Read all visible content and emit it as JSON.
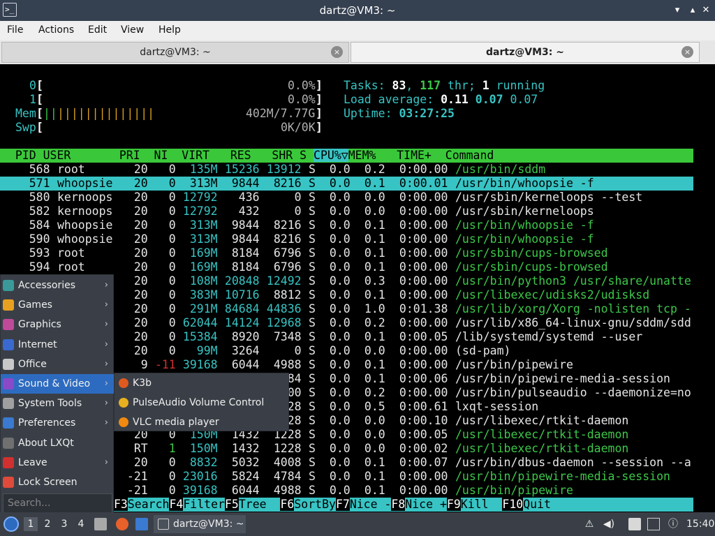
{
  "window": {
    "title": "dartz@VM3: ~",
    "min": "⌃",
    "max": "⌃",
    "close": "✕",
    "term_icon": ">_"
  },
  "menubar": [
    "File",
    "Actions",
    "Edit",
    "View",
    "Help"
  ],
  "tabs": [
    {
      "label": "dartz@VM3: ~",
      "close": "×"
    },
    {
      "label": "dartz@VM3: ~",
      "close": "×"
    }
  ],
  "htop": {
    "cpu0": {
      "num": "0",
      "open": "[",
      "pct": "0.0%",
      "close": "]"
    },
    "cpu1": {
      "num": "1",
      "open": "[",
      "pct": "0.0%",
      "close": "]"
    },
    "mem": {
      "label": "Mem",
      "open": "[",
      "bars": "||",
      "bars2": "||||||||||||||",
      "val": "402M/7.77G",
      "close": "]"
    },
    "swp": {
      "label": "Swp",
      "open": "[",
      "val": "0K/0K",
      "close": "]"
    },
    "tasks": {
      "label": "Tasks: ",
      "count": "83",
      "sep": ", ",
      "thr": "117",
      "thr_lbl": " thr; ",
      "running": "1",
      "running_lbl": " running"
    },
    "load": {
      "label": "Load average: ",
      "v1": "0.11",
      "v2": "0.07",
      "v3": "0.07"
    },
    "uptime": {
      "label": "Uptime: ",
      "value": "03:27:25"
    },
    "header": {
      "pre": "  PID USER       PRI  NI  VIRT   RES   SHR S ",
      "cpu": "CPU%▽",
      "post": "MEM%   TIME+  Command"
    },
    "rows": [
      {
        "pid": "568",
        "user": "root",
        "pri": "20",
        "ni": "0",
        "virt": "135M",
        "res": "15236",
        "shr": "13912",
        "s": "S",
        "cpu": "0.0",
        "mem": "0.2",
        "time": "0:00.00",
        "cmd": "/usr/bin/sddm",
        "cc": "g"
      },
      {
        "pid": "571",
        "user": "whoopsie",
        "pri": "20",
        "ni": "0",
        "virt": "313M",
        "res": "9844",
        "shr": "8216",
        "s": "S",
        "cpu": "0.0",
        "mem": "0.1",
        "time": "0:00.01",
        "cmd": "/usr/bin/whoopsie -f",
        "cc": "k"
      },
      {
        "pid": "580",
        "user": "kernoops",
        "pri": "20",
        "ni": "0",
        "virt": "12792",
        "res": "436",
        "shr": "0",
        "s": "S",
        "cpu": "0.0",
        "mem": "0.0",
        "time": "0:00.00",
        "cmd": "/usr/sbin/kerneloops --test",
        "cc": "w"
      },
      {
        "pid": "582",
        "user": "kernoops",
        "pri": "20",
        "ni": "0",
        "virt": "12792",
        "res": "432",
        "shr": "0",
        "s": "S",
        "cpu": "0.0",
        "mem": "0.0",
        "time": "0:00.00",
        "cmd": "/usr/sbin/kerneloops",
        "cc": "w"
      },
      {
        "pid": "584",
        "user": "whoopsie",
        "pri": "20",
        "ni": "0",
        "virt": "313M",
        "res": "9844",
        "shr": "8216",
        "s": "S",
        "cpu": "0.0",
        "mem": "0.1",
        "time": "0:00.00",
        "cmd": "/usr/bin/whoopsie -f",
        "cc": "g"
      },
      {
        "pid": "590",
        "user": "whoopsie",
        "pri": "20",
        "ni": "0",
        "virt": "313M",
        "res": "9844",
        "shr": "8216",
        "s": "S",
        "cpu": "0.0",
        "mem": "0.1",
        "time": "0:00.00",
        "cmd": "/usr/bin/whoopsie -f",
        "cc": "g"
      },
      {
        "pid": "593",
        "user": "root",
        "pri": "20",
        "ni": "0",
        "virt": "169M",
        "res": "8184",
        "shr": "6796",
        "s": "S",
        "cpu": "0.0",
        "mem": "0.1",
        "time": "0:00.00",
        "cmd": "/usr/sbin/cups-browsed",
        "cc": "g"
      },
      {
        "pid": "594",
        "user": "root",
        "pri": "20",
        "ni": "0",
        "virt": "169M",
        "res": "8184",
        "shr": "6796",
        "s": "S",
        "cpu": "0.0",
        "mem": "0.1",
        "time": "0:00.00",
        "cmd": "/usr/sbin/cups-browsed",
        "cc": "g"
      },
      {
        "pid": "",
        "user": "",
        "pri": "20",
        "ni": "0",
        "virt": "108M",
        "res": "20848",
        "shr": "12492",
        "s": "S",
        "cpu": "0.0",
        "mem": "0.3",
        "time": "0:00.00",
        "cmd": "/usr/bin/python3 /usr/share/unatte",
        "cc": "g"
      },
      {
        "pid": "",
        "user": "",
        "pri": "20",
        "ni": "0",
        "virt": "383M",
        "res": "10716",
        "shr": "8812",
        "s": "S",
        "cpu": "0.0",
        "mem": "0.1",
        "time": "0:00.00",
        "cmd": "/usr/libexec/udisks2/udisksd",
        "cc": "g"
      },
      {
        "pid": "",
        "user": "",
        "pri": "20",
        "ni": "0",
        "virt": "291M",
        "res": "84684",
        "shr": "44836",
        "s": "S",
        "cpu": "0.0",
        "mem": "1.0",
        "time": "0:01.38",
        "cmd": "/usr/lib/xorg/Xorg -nolisten tcp -",
        "cc": "g"
      },
      {
        "pid": "",
        "user": "",
        "pri": "20",
        "ni": "0",
        "virt": "62044",
        "res": "14124",
        "shr": "12968",
        "s": "S",
        "cpu": "0.0",
        "mem": "0.2",
        "time": "0:00.00",
        "cmd": "/usr/lib/x86_64-linux-gnu/sddm/sdd",
        "cc": "w"
      },
      {
        "pid": "",
        "user": "",
        "pri": "20",
        "ni": "0",
        "virt": "15384",
        "res": "8920",
        "shr": "7348",
        "s": "S",
        "cpu": "0.0",
        "mem": "0.1",
        "time": "0:00.05",
        "cmd": "/lib/systemd/systemd --user",
        "cc": "w"
      },
      {
        "pid": "",
        "user": "",
        "pri": "20",
        "ni": "0",
        "virt": "99M",
        "res": "3264",
        "shr": "0",
        "s": "S",
        "cpu": "0.0",
        "mem": "0.0",
        "time": "0:00.00",
        "cmd": "(sd-pam)",
        "cc": "w"
      },
      {
        "pid": "",
        "user": "",
        "pri": "9",
        "ni": "-11",
        "virt": "39168",
        "res": "6044",
        "shr": "4988",
        "s": "S",
        "cpu": "0.0",
        "mem": "0.1",
        "time": "0:00.00",
        "cmd": "/usr/bin/pipewire",
        "cc": "w"
      },
      {
        "pid": "",
        "user": "",
        "pri": "",
        "ni": "",
        "virt": "",
        "res": "",
        "shr": "84",
        "s": "S",
        "cpu": "0.0",
        "mem": "0.1",
        "time": "0:00.06",
        "cmd": "/usr/bin/pipewire-media-session",
        "cc": "w"
      },
      {
        "pid": "",
        "user": "",
        "pri": "",
        "ni": "",
        "virt": "",
        "res": "",
        "shr": "00",
        "s": "S",
        "cpu": "0.0",
        "mem": "0.2",
        "time": "0:00.00",
        "cmd": "/usr/bin/pulseaudio --daemonize=no",
        "cc": "w"
      },
      {
        "pid": "",
        "user": "",
        "pri": "",
        "ni": "",
        "virt": "",
        "res": "",
        "shr": "28",
        "s": "S",
        "cpu": "0.0",
        "mem": "0.5",
        "time": "0:00.61",
        "cmd": "lxqt-session",
        "cc": "w"
      },
      {
        "pid": "",
        "user": "",
        "pri": "",
        "ni": "",
        "virt": "",
        "res": "",
        "shr": "28",
        "s": "S",
        "cpu": "0.0",
        "mem": "0.0",
        "time": "0:00.10",
        "cmd": "/usr/libexec/rtkit-daemon",
        "cc": "w"
      },
      {
        "pid": "",
        "user": "",
        "pri": "20",
        "ni": "0",
        "virt": "150M",
        "res": "1432",
        "shr": "1228",
        "s": "S",
        "cpu": "0.0",
        "mem": "0.0",
        "time": "0:00.05",
        "cmd": "/usr/libexec/rtkit-daemon",
        "cc": "g"
      },
      {
        "pid": "",
        "user": "",
        "pri": "RT",
        "ni": "1",
        "virt": "150M",
        "res": "1432",
        "shr": "1228",
        "s": "S",
        "cpu": "0.0",
        "mem": "0.0",
        "time": "0:00.02",
        "cmd": "/usr/libexec/rtkit-daemon",
        "cc": "g"
      },
      {
        "pid": "",
        "user": "",
        "pri": "20",
        "ni": "0",
        "virt": "8832",
        "res": "5032",
        "shr": "4008",
        "s": "S",
        "cpu": "0.0",
        "mem": "0.1",
        "time": "0:00.07",
        "cmd": "/usr/bin/dbus-daemon --session --a",
        "cc": "w"
      },
      {
        "pid": "",
        "user": "",
        "pri": "-21",
        "ni": "0",
        "virt": "23016",
        "res": "5824",
        "shr": "4784",
        "s": "S",
        "cpu": "0.0",
        "mem": "0.1",
        "time": "0:00.00",
        "cmd": "/usr/bin/pipewire-media-session",
        "cc": "g"
      },
      {
        "pid": "",
        "user": "",
        "pri": "-21",
        "ni": "0",
        "virt": "39168",
        "res": "6044",
        "shr": "4988",
        "s": "S",
        "cpu": "0.0",
        "mem": "0.1",
        "time": "0:00.00",
        "cmd": "/usr/bin/pipewire",
        "cc": "g"
      }
    ],
    "fkeys": [
      [
        "F3",
        "Search"
      ],
      [
        "F4",
        "Filter"
      ],
      [
        "F5",
        "Tree  "
      ],
      [
        "F6",
        "SortBy"
      ],
      [
        "F7",
        "Nice -"
      ],
      [
        "F8",
        "Nice +"
      ],
      [
        "F9",
        "Kill  "
      ],
      [
        "F10",
        "Quit"
      ]
    ]
  },
  "launcher": {
    "items": [
      {
        "label": "Accessories",
        "arrow": "›",
        "color": "#3a9a9a"
      },
      {
        "label": "Games",
        "arrow": "›",
        "color": "#e8a020"
      },
      {
        "label": "Graphics",
        "arrow": "›",
        "color": "#c04a9a"
      },
      {
        "label": "Internet",
        "arrow": "›",
        "color": "#3a6ad0"
      },
      {
        "label": "Office",
        "arrow": "›",
        "color": "#c8c8c8"
      },
      {
        "label": "Sound & Video",
        "arrow": "›",
        "color": "#8a4ac8"
      },
      {
        "label": "System Tools",
        "arrow": "›",
        "color": "#a0a0a0"
      },
      {
        "label": "Preferences",
        "arrow": "›",
        "color": "#3a7ad0"
      },
      {
        "label": "About LXQt",
        "arrow": "",
        "color": "#707070"
      },
      {
        "label": "Leave",
        "arrow": "›",
        "color": "#d03030"
      },
      {
        "label": "Lock Screen",
        "arrow": "",
        "color": "#e04a3a"
      }
    ],
    "search_placeholder": "Search...",
    "submenu": [
      {
        "label": "K3b",
        "color": "#e05a20"
      },
      {
        "label": "PulseAudio Volume Control",
        "color": "#e8b020"
      },
      {
        "label": "VLC media player",
        "color": "#f08a10"
      }
    ]
  },
  "taskbar": {
    "desktops": [
      "1",
      "2",
      "3",
      "4"
    ],
    "window_label": "dartz@VM3: ~",
    "clock": "15:40"
  },
  "colors": {
    "header_bar": "#3ac83a",
    "selected_row": "#38c4c4",
    "fkey_bar": "#38c4c4",
    "accent": "#2d6bc0"
  }
}
